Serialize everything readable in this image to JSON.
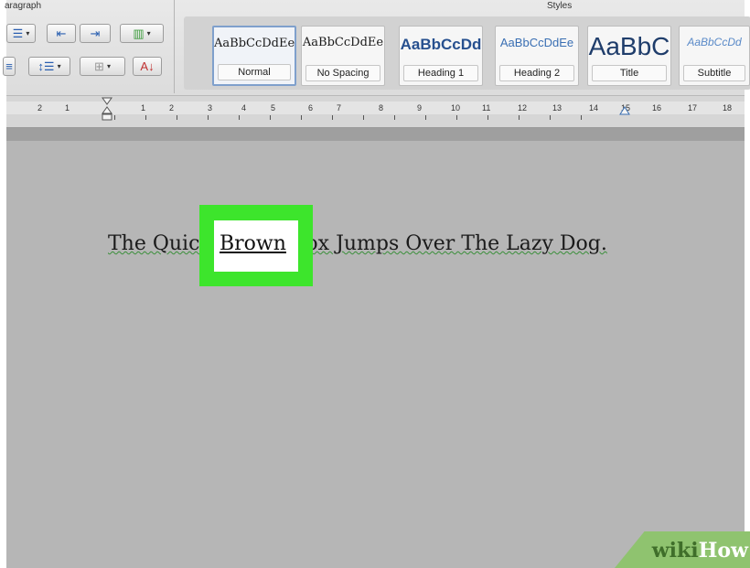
{
  "ribbon": {
    "paragraph_group_title": "aragraph",
    "styles_group_title": "Styles",
    "styles": [
      {
        "sample": "AaBbCcDdEe",
        "name": "Normal",
        "selected": true,
        "sample_color": "#1a1a1a"
      },
      {
        "sample": "AaBbCcDdEe",
        "name": "No Spacing",
        "selected": false,
        "sample_color": "#1a1a1a"
      },
      {
        "sample": "AaBbCcDd",
        "name": "Heading 1",
        "selected": false,
        "sample_color": "#27508f"
      },
      {
        "sample": "AaBbCcDdEe",
        "name": "Heading 2",
        "selected": false,
        "sample_color": "#3a6fb3"
      },
      {
        "sample": "AaBbC",
        "name": "Title",
        "selected": false,
        "sample_color": "#1f3d6b"
      },
      {
        "sample": "AaBbCcDd",
        "name": "Subtitle",
        "selected": false,
        "sample_color": "#5a8ac8"
      }
    ]
  },
  "ruler": {
    "ticks": [
      "2",
      "1",
      "1",
      "2",
      "3",
      "4",
      "5",
      "6",
      "7",
      "8",
      "9",
      "10",
      "11",
      "12",
      "13",
      "14",
      "15",
      "16",
      "17",
      "18"
    ]
  },
  "document": {
    "text_before": "The Quic",
    "highlighted_word": "Brown",
    "text_after": "ox Jumps Over The Lazy Dog."
  },
  "watermark": {
    "part1": "wiki",
    "part2": "How"
  },
  "colors": {
    "highlight_box": "#3de52c",
    "canvas": "#b6b6b6",
    "ribbon": "#e2e2e2",
    "watermark_bg": "#8fc36f"
  }
}
